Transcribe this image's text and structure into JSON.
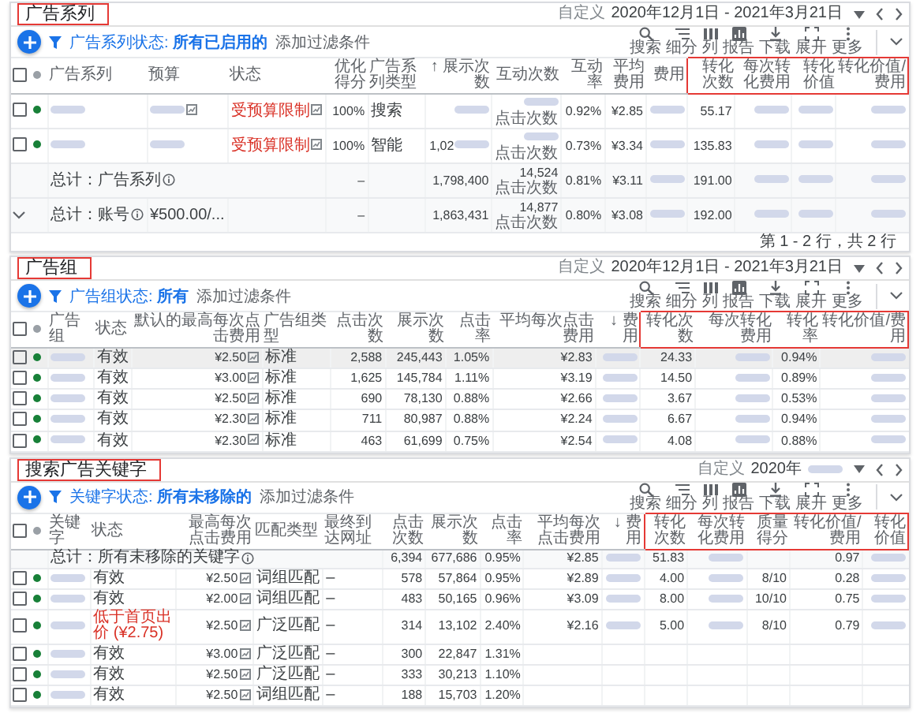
{
  "panels": [
    {
      "title": "广告系列",
      "title_highlighted": true,
      "header_checked": false,
      "date": {
        "label": "自定义",
        "range": "2020年12月1日 - 2021年3月21日"
      },
      "filter": {
        "text": "广告系列状态: **所有已启用的**",
        "add": "添加过滤条件"
      },
      "toolbar": [
        {
          "label": "搜索",
          "kind": "search"
        },
        {
          "label": "细分",
          "kind": "segment"
        },
        {
          "label": "列",
          "kind": "columns"
        },
        {
          "label": "报告",
          "kind": "report"
        },
        {
          "label": "下载",
          "kind": "download"
        },
        {
          "label": "展开",
          "kind": "expand"
        },
        {
          "label": "更多",
          "kind": "more"
        }
      ],
      "columns": [
        {
          "label": "广告系列",
          "kind": "text",
          "highlighted": false
        },
        {
          "label": "预算",
          "kind": "text",
          "highlighted": false
        },
        {
          "label": "状态",
          "kind": "text",
          "highlighted": false
        },
        {
          "label": "优化得分",
          "kind": "num",
          "highlighted": false
        },
        {
          "label": "广告系列类型",
          "kind": "text",
          "highlighted": false
        },
        {
          "label": "↑ 展示次数",
          "kind": "num",
          "highlighted": false
        },
        {
          "label": "互动次数",
          "kind": "num",
          "highlighted": false
        },
        {
          "label": "互动率",
          "kind": "num",
          "highlighted": false
        },
        {
          "label": "平均费用",
          "kind": "num",
          "highlighted": false
        },
        {
          "label": "费用",
          "kind": "num",
          "highlighted": false
        },
        {
          "label": "转化次数",
          "kind": "num",
          "highlighted": true
        },
        {
          "label": "每次转化费用",
          "kind": "num",
          "highlighted": true
        },
        {
          "label": "转化价值",
          "kind": "num",
          "highlighted": true
        },
        {
          "label": "转化价值/费用",
          "kind": "num",
          "highlighted": true
        }
      ],
      "rows": [
        {
          "kind": "item",
          "checked": false,
          "cells": [
            {
              "blurred": true
            },
            {
              "blurred": true,
              "icon": true
            },
            {
              "text": "受预算限制",
              "alert": true,
              "icon": true
            },
            "100%",
            "搜索",
            {
              "blurred": true
            },
            {
              "blurred": true,
              "note": "点击次数"
            },
            "0.92%",
            "¥2.85",
            {
              "blurred": true
            },
            "55.17",
            {
              "blurred": true
            },
            {
              "blurred": true
            },
            {
              "blurred": true
            }
          ]
        },
        {
          "kind": "item",
          "checked": false,
          "cells": [
            {
              "blurred": true
            },
            {
              "blurred": true
            },
            {
              "text": "受预算限制",
              "alert": true,
              "icon": true
            },
            "100%",
            "智能",
            {
              "text": "1,02",
              "blurred": true
            },
            {
              "blurred": true,
              "note": "点击次数"
            },
            "0.73%",
            "¥3.34",
            {
              "blurred": true
            },
            "135.83",
            {
              "blurred": true
            },
            {
              "blurred": true
            },
            {
              "blurred": true
            }
          ]
        },
        {
          "kind": "total",
          "cells": [
            {
              "text": "总计：广告系列",
              "info": true,
              "colspan": 3
            },
            "–",
            {},
            "1,798,400",
            {
              "text": "14,524",
              "note": "点击次数"
            },
            "0.81%",
            "¥3.11",
            {
              "blurred": true
            },
            "191.00",
            {
              "blurred": true
            },
            {
              "blurred": true
            },
            {
              "blurred": true
            }
          ]
        },
        {
          "kind": "total",
          "expander": true,
          "cells": [
            {
              "text": "总计：账号",
              "info": true
            },
            "¥500.00/...",
            {},
            "–",
            {},
            "1,863,431",
            {
              "text": "14,877",
              "note": "点击次数"
            },
            "0.80%",
            "¥3.08",
            {
              "blurred": true
            },
            "192.00",
            {
              "blurred": true
            },
            {
              "blurred": true
            },
            {
              "blurred": true
            }
          ]
        }
      ],
      "footer": "第 1 - 2 行，共 2 行"
    },
    {
      "title": "广告组",
      "title_highlighted": true,
      "header_checked": false,
      "date": {
        "label": "自定义",
        "range": "2020年12月1日 - 2021年3月21日"
      },
      "filter": {
        "text": "广告组状态: **所有**",
        "add": "添加过滤条件"
      },
      "toolbar": [
        {
          "label": "搜索",
          "kind": "search"
        },
        {
          "label": "细分",
          "kind": "segment"
        },
        {
          "label": "列",
          "kind": "columns"
        },
        {
          "label": "报告",
          "kind": "report"
        },
        {
          "label": "下载",
          "kind": "download"
        },
        {
          "label": "展开",
          "kind": "expand"
        },
        {
          "label": "更多",
          "kind": "more"
        }
      ],
      "columns": [
        {
          "label": "广告组",
          "kind": "text",
          "highlighted": false
        },
        {
          "label": "状态",
          "kind": "text",
          "highlighted": false
        },
        {
          "label": "默认的最高每次点击费用",
          "kind": "num",
          "highlighted": false
        },
        {
          "label": "广告组类型",
          "kind": "text",
          "highlighted": false
        },
        {
          "label": "点击次数",
          "kind": "num",
          "highlighted": false
        },
        {
          "label": "展示次数",
          "kind": "num",
          "highlighted": false
        },
        {
          "label": "点击率",
          "kind": "num",
          "highlighted": false
        },
        {
          "label": "平均每次点击费用",
          "kind": "num",
          "highlighted": false
        },
        {
          "label": "↓ 费用",
          "kind": "num",
          "highlighted": false
        },
        {
          "label": "转化次数",
          "kind": "num",
          "highlighted": true
        },
        {
          "label": "每次转化费用",
          "kind": "num",
          "highlighted": true
        },
        {
          "label": "转化率",
          "kind": "num",
          "highlighted": true
        },
        {
          "label": "转化价值/费用",
          "kind": "num",
          "highlighted": true
        }
      ],
      "rows": [
        {
          "kind": "item",
          "checked": false,
          "highlighted": true,
          "cells": [
            {
              "blurred": true
            },
            "有效",
            {
              "text": "¥2.50",
              "icon": true
            },
            "标准",
            "2,588",
            "245,443",
            "1.05%",
            "¥2.83",
            {
              "blurred": true
            },
            "24.33",
            {
              "blurred": true
            },
            "0.94%",
            {
              "blurred": true
            }
          ]
        },
        {
          "kind": "item",
          "checked": false,
          "highlighted": false,
          "cells": [
            {
              "blurred": true
            },
            "有效",
            {
              "text": "¥3.00",
              "icon": true
            },
            "标准",
            "1,625",
            "145,784",
            "1.11%",
            "¥3.19",
            {
              "blurred": true
            },
            "14.50",
            {
              "blurred": true
            },
            "0.89%",
            {
              "blurred": true
            }
          ]
        },
        {
          "kind": "item",
          "checked": false,
          "highlighted": false,
          "cells": [
            {
              "blurred": true
            },
            "有效",
            {
              "text": "¥2.50",
              "icon": true
            },
            "标准",
            "690",
            "78,130",
            "0.88%",
            "¥2.66",
            {
              "blurred": true
            },
            "3.67",
            {
              "blurred": true
            },
            "0.53%",
            {
              "blurred": true
            }
          ]
        },
        {
          "kind": "item",
          "checked": false,
          "highlighted": false,
          "cells": [
            {
              "blurred": true
            },
            "有效",
            {
              "text": "¥2.30",
              "icon": true
            },
            "标准",
            "711",
            "80,987",
            "0.88%",
            "¥2.24",
            {
              "blurred": true
            },
            "6.67",
            {
              "blurred": true
            },
            "0.94%",
            {
              "blurred": true
            }
          ]
        },
        {
          "kind": "item",
          "checked": false,
          "highlighted": false,
          "cells": [
            {
              "blurred": true
            },
            "有效",
            {
              "text": "¥2.30",
              "icon": true
            },
            "标准",
            "463",
            "61,699",
            "0.75%",
            "¥2.54",
            {
              "blurred": true
            },
            "4.08",
            {
              "blurred": true
            },
            "0.88%",
            {
              "blurred": true
            }
          ]
        }
      ]
    },
    {
      "title": "搜索广告关键字",
      "title_highlighted": true,
      "header_checked": false,
      "date": {
        "label": "自定义",
        "range": "2020年",
        "blurred": true
      },
      "filter": {
        "text": "关键字状态: **所有未移除的**",
        "add": "添加过滤条件"
      },
      "toolbar": [
        {
          "label": "搜索",
          "kind": "search"
        },
        {
          "label": "细分",
          "kind": "segment"
        },
        {
          "label": "列",
          "kind": "columns"
        },
        {
          "label": "报告",
          "kind": "report"
        },
        {
          "label": "下载",
          "kind": "download"
        },
        {
          "label": "展开",
          "kind": "expand"
        },
        {
          "label": "更多",
          "kind": "more"
        }
      ],
      "columns": [
        {
          "label": "关键字",
          "kind": "text",
          "highlighted": false
        },
        {
          "label": "状态",
          "kind": "text",
          "highlighted": false
        },
        {
          "label": "最高每次点击费用",
          "kind": "num",
          "highlighted": false
        },
        {
          "label": "匹配类型",
          "kind": "text",
          "highlighted": false
        },
        {
          "label": "最终到达网址",
          "kind": "text",
          "highlighted": false
        },
        {
          "label": "点击次数",
          "kind": "num",
          "highlighted": false
        },
        {
          "label": "展示次数",
          "kind": "num",
          "highlighted": false
        },
        {
          "label": "点击率",
          "kind": "num",
          "highlighted": false
        },
        {
          "label": "平均每次点击费用",
          "kind": "num",
          "highlighted": false
        },
        {
          "label": "↓ 费用",
          "kind": "num",
          "highlighted": false
        },
        {
          "label": "转化次数",
          "kind": "num",
          "highlighted": true
        },
        {
          "label": "每次转化费用",
          "kind": "num",
          "highlighted": true
        },
        {
          "label": "质量得分",
          "kind": "num",
          "highlighted": true
        },
        {
          "label": "转化价值/费用",
          "kind": "num",
          "highlighted": true
        },
        {
          "label": "转化价值",
          "kind": "num",
          "highlighted": true
        }
      ],
      "rows": [
        {
          "kind": "total",
          "cells": [
            {
              "text": "总计：所有未移除的关键字",
              "info": true,
              "colspan": 5
            },
            "6,394",
            "677,686",
            "0.95%",
            "¥2.85",
            {
              "blurred": true
            },
            "51.83",
            {
              "blurred": true
            },
            {},
            "0.97",
            {
              "blurred": true
            }
          ]
        },
        {
          "kind": "item",
          "checked": false,
          "cells": [
            {
              "blurred": true
            },
            "有效",
            {
              "text": "¥2.50",
              "icon": true
            },
            "词组匹配",
            "–",
            "578",
            "57,864",
            "0.95%",
            "¥2.89",
            {
              "blurred": true
            },
            "4.00",
            {
              "blurred": true
            },
            "8/10",
            "0.28",
            {
              "blurred": true
            }
          ]
        },
        {
          "kind": "item",
          "checked": false,
          "cells": [
            {
              "blurred": true
            },
            "有效",
            {
              "text": "¥2.00",
              "icon": true
            },
            "词组匹配",
            "–",
            "483",
            "50,165",
            "0.96%",
            "¥3.09",
            {
              "blurred": true
            },
            "8.00",
            {
              "blurred": true
            },
            "10/10",
            "0.75",
            {
              "blurred": true
            }
          ]
        },
        {
          "kind": "item",
          "checked": false,
          "cells": [
            {
              "blurred": true
            },
            {
              "text": "低于首页出价 (¥2.75)",
              "alert": true
            },
            {
              "text": "¥2.50",
              "icon": true
            },
            "广泛匹配",
            "–",
            "314",
            "13,102",
            "2.40%",
            "¥2.16",
            {
              "blurred": true
            },
            "5.00",
            {
              "blurred": true
            },
            "8/10",
            "0.79",
            {
              "blurred": true
            }
          ]
        },
        {
          "kind": "item",
          "checked": false,
          "cells": [
            {
              "blurred": true
            },
            "有效",
            {
              "text": "¥3.00",
              "icon": true
            },
            "广泛匹配",
            "–",
            "300",
            "22,847",
            "1.31%",
            {},
            {},
            {},
            {},
            {},
            {},
            {}
          ]
        },
        {
          "kind": "item",
          "checked": false,
          "cells": [
            {
              "blurred": true
            },
            "有效",
            {
              "text": "¥2.50",
              "icon": true
            },
            "广泛匹配",
            "–",
            "333",
            "30,213",
            "1.10%",
            {},
            {},
            {},
            {},
            {},
            {},
            {}
          ]
        },
        {
          "kind": "item",
          "checked": false,
          "cells": [
            {
              "blurred": true
            },
            "有效",
            {
              "text": "¥2.50",
              "icon": true
            },
            "词组匹配",
            "–",
            "188",
            "15,703",
            "1.20%",
            {},
            {},
            {},
            {},
            {},
            {},
            {}
          ]
        }
      ]
    }
  ]
}
